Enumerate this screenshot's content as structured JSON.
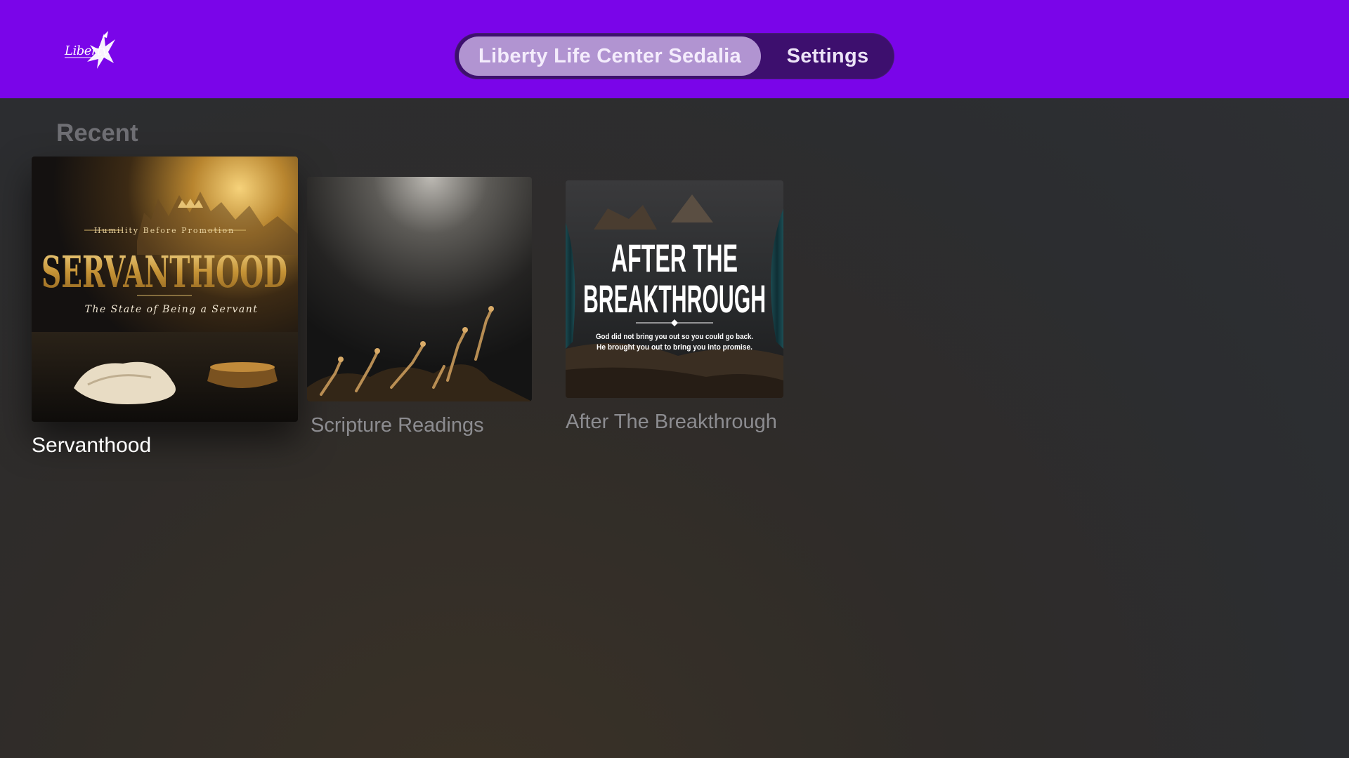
{
  "app": {
    "logo_text": "Liberty"
  },
  "nav": {
    "tabs": [
      {
        "label": "Liberty Life Center Sedalia",
        "active": true
      },
      {
        "label": "Settings",
        "active": false
      }
    ]
  },
  "recent": {
    "title": "Recent",
    "items": [
      {
        "label": "Servanthood",
        "focused": true,
        "artwork": {
          "top_line": "Humility Before Promotion",
          "title": "SERVANTHOOD",
          "subtitle": "The State of Being a Servant"
        }
      },
      {
        "label": "Scripture Readings",
        "focused": false
      },
      {
        "label": "After The Breakthrough",
        "focused": false,
        "artwork": {
          "title_line1": "AFTER THE",
          "title_line2": "BREAKTHROUGH",
          "caption_line1": "God did not bring you out so you could go back.",
          "caption_line2": "He brought you out to bring you into promise."
        }
      }
    ]
  },
  "colors": {
    "topbar": "#7a05e9",
    "pill_background": "#3d0f6e",
    "active_tab": "#dec8f8",
    "background": "#2e2e30",
    "focused_label": "#ffffff",
    "inactive_label": "#8c8c90"
  }
}
